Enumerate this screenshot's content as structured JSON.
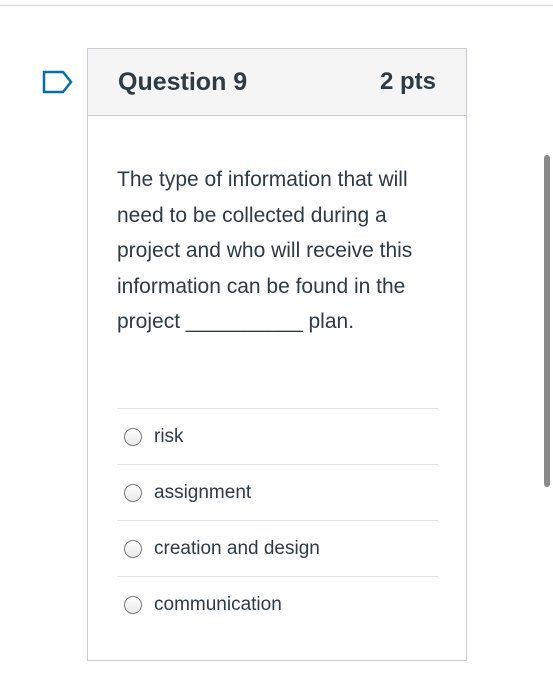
{
  "question": {
    "title": "Question 9",
    "points": "2 pts",
    "text": "The type of information that will need to be collected during a project and who will receive this information can be found in the project __________ plan."
  },
  "answers": [
    {
      "label": "risk",
      "selected": false
    },
    {
      "label": "assignment",
      "selected": false
    },
    {
      "label": "creation and design",
      "selected": false
    },
    {
      "label": "communication",
      "selected": false
    }
  ],
  "icons": {
    "flag": "flag-question-icon"
  },
  "colors": {
    "accent": "#0770a3",
    "text": "#2d3b45",
    "header_bg": "#f5f5f5",
    "border": "#c7cdd1"
  }
}
